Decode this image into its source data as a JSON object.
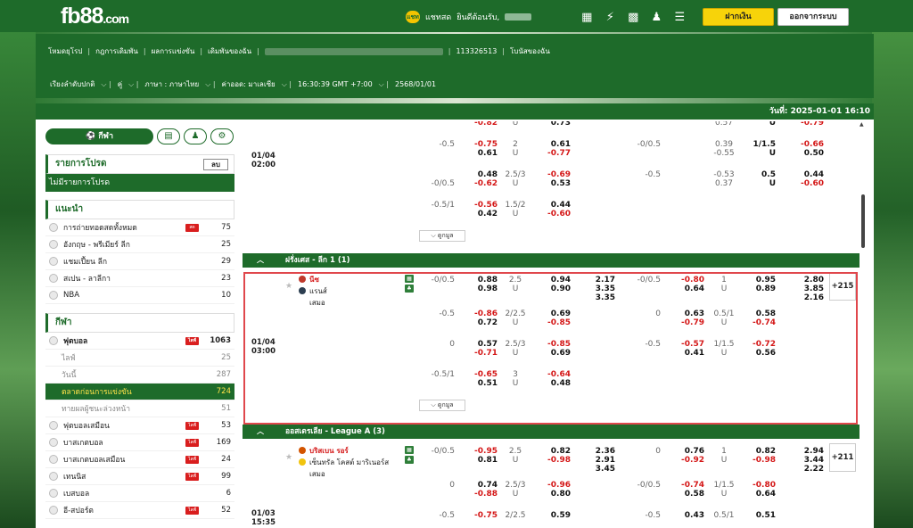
{
  "brand": {
    "logo": "fb88",
    "logo_tld": ".com"
  },
  "header": {
    "chat_badge": "แชท",
    "chat_label": "แชทสด",
    "welcome": "ยินดีต้อนรับ,",
    "deposit": "ฝากเงิน",
    "logout": "ออกจากระบบ"
  },
  "nav": {
    "links": [
      "โหมดยุโรป",
      "กฎการเดิมพัน",
      "ผลการแข่งขัน",
      "เดิมพันของฉัน"
    ],
    "account_id": "113326513",
    "bonus": "โบนัสของฉัน",
    "settings": [
      "เรียงลำดับปกติ",
      "คู่",
      "ภาษา : ภาษาไทย",
      "ค่าออด: มาเลเซีย",
      "16:30:39 GMT +7:00",
      "2568/01/01"
    ]
  },
  "datebar": "วันที่: 2025-01-01 16:10",
  "sidebar": {
    "sport_main": "กีฬา",
    "favorites_title": "รายการโปรด",
    "favorites_delete": "ลบ",
    "favorites_empty": "ไม่มีรายการโปรด",
    "recommend_title": "แนะนำ",
    "recommend": [
      {
        "label": "การถ่ายทอดสดทั้งหมด",
        "count": "75",
        "tag": "สด"
      },
      {
        "label": "อังกฤษ - พรีเมียร์ ลีก",
        "count": "25"
      },
      {
        "label": "แชมเปี้ยน ลีก",
        "count": "29"
      },
      {
        "label": "สเปน - ลาลีกา",
        "count": "23"
      },
      {
        "label": "NBA",
        "count": "10"
      }
    ],
    "sports_title": "กีฬา",
    "sports": [
      {
        "label": "ฟุตบอล",
        "count": "1063",
        "tag": "ไลฟ์",
        "bold": true
      },
      {
        "label": "ไลฟ์",
        "count": "25",
        "sub": true
      },
      {
        "label": "วันนี้",
        "count": "287",
        "sub": true
      },
      {
        "label": "ตลาดก่อนการแข่งขัน",
        "count": "724",
        "sub": true,
        "active": true
      },
      {
        "label": "ทายผลผู้ชนะล่วงหน้า",
        "count": "51",
        "sub": true
      },
      {
        "label": "ฟุตบอลเสมือน",
        "count": "53",
        "tag": "ไลฟ์"
      },
      {
        "label": "บาสเกตบอล",
        "count": "169",
        "tag": "ไลฟ์"
      },
      {
        "label": "บาสเกตบอลเสมือน",
        "count": "24",
        "tag": "ไลฟ์"
      },
      {
        "label": "เทนนิส",
        "count": "99",
        "tag": "ไลฟ์"
      },
      {
        "label": "เบสบอล",
        "count": "6"
      },
      {
        "label": "อี-สปอร์ต",
        "count": "52",
        "tag": "ไลฟ์"
      }
    ]
  },
  "matches": {
    "expand_label": "ดูกมูล",
    "block1": {
      "date": "01/04",
      "time": "02:00",
      "rows": [
        [
          "",
          "-0.82",
          "U",
          "0.73",
          "",
          "",
          "",
          "0.57",
          "U",
          "-0.79"
        ],
        [
          "-0.5",
          "-0.75",
          "2",
          "0.61",
          "",
          "-0/0.5",
          "",
          "0.39",
          "1/1.5",
          "-0.66"
        ],
        [
          "",
          "0.61",
          "U",
          "-0.77",
          "",
          "",
          "",
          "-0.55",
          "U",
          "0.50"
        ],
        [
          "",
          "0.48",
          "2.5/3",
          "-0.69",
          "",
          "-0.5",
          "",
          "-0.53",
          "0.5",
          "0.44"
        ],
        [
          "-0/0.5",
          "-0.62",
          "U",
          "0.53",
          "",
          "",
          "",
          "0.37",
          "U",
          "-0.60"
        ],
        [
          "-0.5/1",
          "-0.56",
          "1.5/2",
          "0.44",
          "",
          "",
          "",
          "",
          "",
          ""
        ],
        [
          "",
          "0.42",
          "U",
          "-0.60",
          "",
          "",
          "",
          "",
          "",
          ""
        ]
      ]
    },
    "league1": "ฝรั่งเศส - ลีก 1 (1)",
    "match2": {
      "home": "นีซ",
      "away": "แรนส์",
      "draw": "เสมอ",
      "date": "01/04",
      "time": "03:00",
      "more": "+215",
      "main": [
        "-0/0.5",
        "0.88",
        "2.5",
        "0.94",
        "2.17",
        "-0/0.5",
        "-0.80",
        "1",
        "0.95",
        "2.80"
      ],
      "main2": [
        "",
        "0.98",
        "U",
        "0.90",
        "3.35",
        "",
        "0.64",
        "U",
        "0.89",
        "3.85"
      ],
      "main3": [
        "",
        "",
        "",
        "",
        "3.35",
        "",
        "",
        "",
        "",
        "2.16"
      ],
      "rows": [
        [
          "-0.5",
          "-0.86",
          "2/2.5",
          "0.69",
          "",
          "0",
          "0.63",
          "0.5/1",
          "0.58",
          ""
        ],
        [
          "",
          "0.72",
          "U",
          "-0.85",
          "",
          "",
          "-0.79",
          "U",
          "-0.74",
          ""
        ],
        [
          "0",
          "0.57",
          "2.5/3",
          "-0.85",
          "",
          "-0.5",
          "-0.57",
          "1/1.5",
          "-0.72",
          ""
        ],
        [
          "",
          "-0.71",
          "U",
          "0.69",
          "",
          "",
          "0.41",
          "U",
          "0.56",
          ""
        ],
        [
          "-0.5/1",
          "-0.65",
          "3",
          "-0.64",
          "",
          "",
          "",
          "",
          "",
          ""
        ],
        [
          "",
          "0.51",
          "U",
          "0.48",
          "",
          "",
          "",
          "",
          "",
          ""
        ]
      ]
    },
    "league2": "ออสเตรเลีย - League A (3)",
    "match3": {
      "home": "บริสเบน รอร์",
      "away": "เซ็นทรัล โคสต์ มาริเนอร์ส",
      "draw": "เสมอ",
      "date": "01/03",
      "time": "15:35",
      "more": "+211",
      "main": [
        "-0/0.5",
        "-0.95",
        "2.5",
        "0.82",
        "2.36",
        "0",
        "0.76",
        "1",
        "0.82",
        "2.94"
      ],
      "main2": [
        "",
        "0.81",
        "U",
        "-0.98",
        "2.91",
        "",
        "-0.92",
        "U",
        "-0.98",
        "3.44"
      ],
      "main3": [
        "",
        "",
        "",
        "",
        "3.45",
        "",
        "",
        "",
        "",
        "2.22"
      ],
      "rows": [
        [
          "0",
          "0.74",
          "2.5/3",
          "-0.96",
          "",
          "-0/0.5",
          "-0.74",
          "1/1.5",
          "-0.80",
          ""
        ],
        [
          "",
          "-0.88",
          "U",
          "0.80",
          "",
          "",
          "0.58",
          "U",
          "0.64",
          ""
        ],
        [
          "-0.5",
          "-0.75",
          "2/2.5",
          "0.59",
          "",
          "-0.5",
          "0.43",
          "0.5/1",
          "0.51",
          ""
        ]
      ]
    }
  },
  "colors": {
    "brand_green": "#1e6b2a",
    "highlight_red": "#e0474c",
    "odds_red": "#d41717",
    "deposit_yellow": "#f7d30a"
  }
}
